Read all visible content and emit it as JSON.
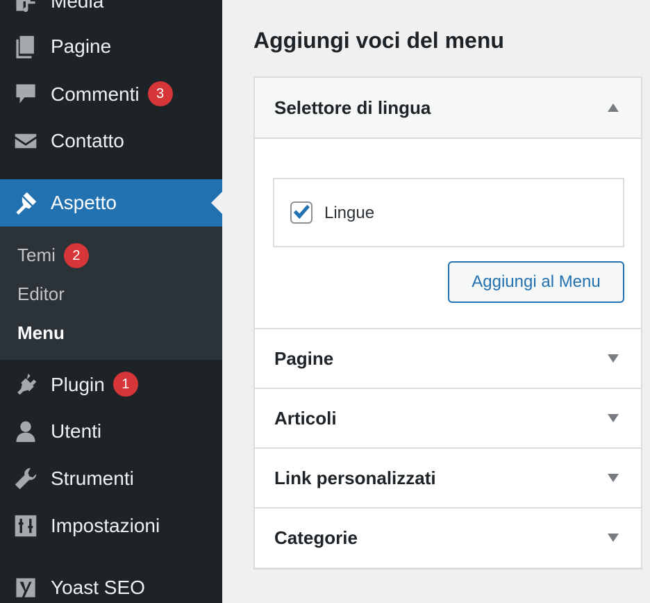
{
  "sidebar": {
    "items": [
      {
        "label": "Media",
        "icon": "media-icon"
      },
      {
        "label": "Pagine",
        "icon": "pages-icon"
      },
      {
        "label": "Commenti",
        "icon": "comments-icon",
        "badge": "3"
      },
      {
        "label": "Contatto",
        "icon": "mail-icon"
      },
      {
        "label": "Aspetto",
        "icon": "appearance-icon",
        "active": true
      },
      {
        "label": "Plugin",
        "icon": "plugin-icon",
        "badge": "1"
      },
      {
        "label": "Utenti",
        "icon": "users-icon"
      },
      {
        "label": "Strumenti",
        "icon": "tools-icon"
      },
      {
        "label": "Impostazioni",
        "icon": "settings-icon"
      },
      {
        "label": "Yoast SEO",
        "icon": "yoast-icon"
      }
    ],
    "submenu": [
      {
        "label": "Temi",
        "badge": "2"
      },
      {
        "label": "Editor"
      },
      {
        "label": "Menu",
        "current": true
      }
    ]
  },
  "main": {
    "title": "Aggiungi voci del menu",
    "accordion": [
      {
        "label": "Selettore di lingua",
        "expanded": true
      },
      {
        "label": "Pagine",
        "expanded": false
      },
      {
        "label": "Articoli",
        "expanded": false
      },
      {
        "label": "Link personalizzati",
        "expanded": false
      },
      {
        "label": "Categorie",
        "expanded": false
      }
    ],
    "language_switcher": {
      "checkbox_label": "Lingue",
      "checked": true,
      "add_button": "Aggiungi al Menu"
    }
  },
  "colors": {
    "sidebar_bg": "#1d2327",
    "submenu_bg": "#2c3338",
    "accent": "#2271b1",
    "badge": "#d63638"
  }
}
